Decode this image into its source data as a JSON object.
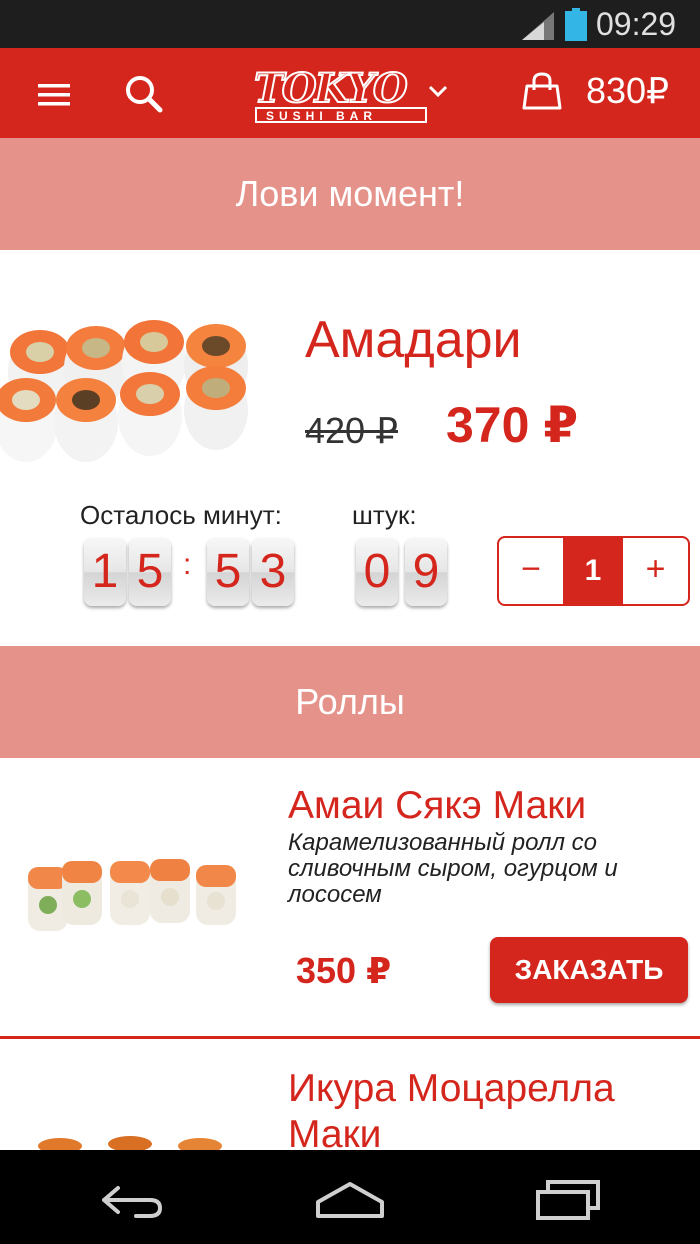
{
  "status_bar": {
    "time": "09:29",
    "signal_icon": "signal-icon",
    "battery_icon": "battery-icon"
  },
  "app_bar": {
    "menu_icon": "menu-icon",
    "search_icon": "search-icon",
    "logo_text": "TOKYO",
    "logo_subtext": "SUSHI BAR",
    "cart_total": "830₽",
    "colors": {
      "brand": "#d4261d",
      "section_bg": "#e5938a"
    }
  },
  "promo": {
    "header": "Лови момент!",
    "name": "Амадари",
    "old_price": "420 ₽",
    "new_price": "370 ₽",
    "minutes_label": "Осталось минут:",
    "pieces_label": "штук:",
    "timer": [
      "1",
      "5",
      "5",
      "3"
    ],
    "timer_separator": ":",
    "pieces": [
      "0",
      "9"
    ],
    "quantity": {
      "minus": "−",
      "value": "1",
      "plus": "+"
    }
  },
  "section": {
    "title": "Роллы"
  },
  "products": [
    {
      "name": "Амаи Сякэ Маки",
      "description": "Карамелизованный ролл со сливочным сыром, огурцом и лососем",
      "price": "350 ₽",
      "order_label": "ЗАКАЗАТЬ"
    },
    {
      "name": "Икура Моцарелла Маки"
    }
  ],
  "nav_bar": {
    "back_icon": "back-icon",
    "home_icon": "home-icon",
    "recent_icon": "recent-apps-icon"
  }
}
